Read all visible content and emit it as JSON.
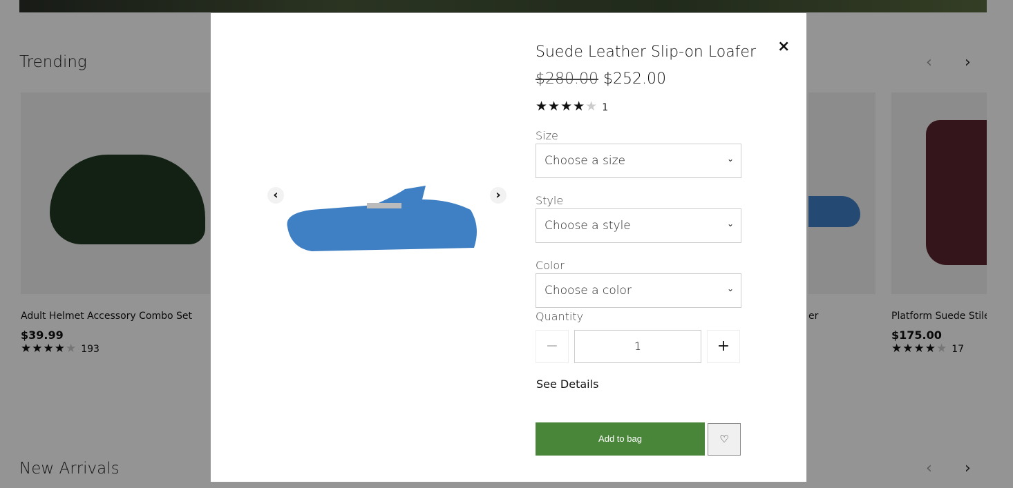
{
  "sections": {
    "trending": "Trending",
    "new_arrivals": "New Arrivals"
  },
  "cards": [
    {
      "name": "Adult Helmet Accessory Combo Set",
      "price": "$39.99",
      "rating": 4,
      "count": "193"
    },
    {
      "name": "er",
      "price": "",
      "rating": 0,
      "count": ""
    },
    {
      "name": "Platform Suede Stile",
      "price": "$175.00",
      "rating": 4,
      "count": "17"
    }
  ],
  "modal": {
    "title": "Suede Leather Slip-on Loafer",
    "old_price": "$280.00",
    "price": "$252.00",
    "rating": 4,
    "review_count": "1",
    "size_label": "Size",
    "size_value": "Choose a size",
    "style_label": "Style",
    "style_value": "Choose a style",
    "color_label": "Color",
    "color_value": "Choose a color",
    "quantity_label": "Quantity",
    "quantity": "1",
    "see_details": "See Details",
    "add_to_bag": "Add to bag",
    "close": "×"
  },
  "colors": {
    "accent": "#4a863a",
    "shoe": "#3f7fc4"
  }
}
